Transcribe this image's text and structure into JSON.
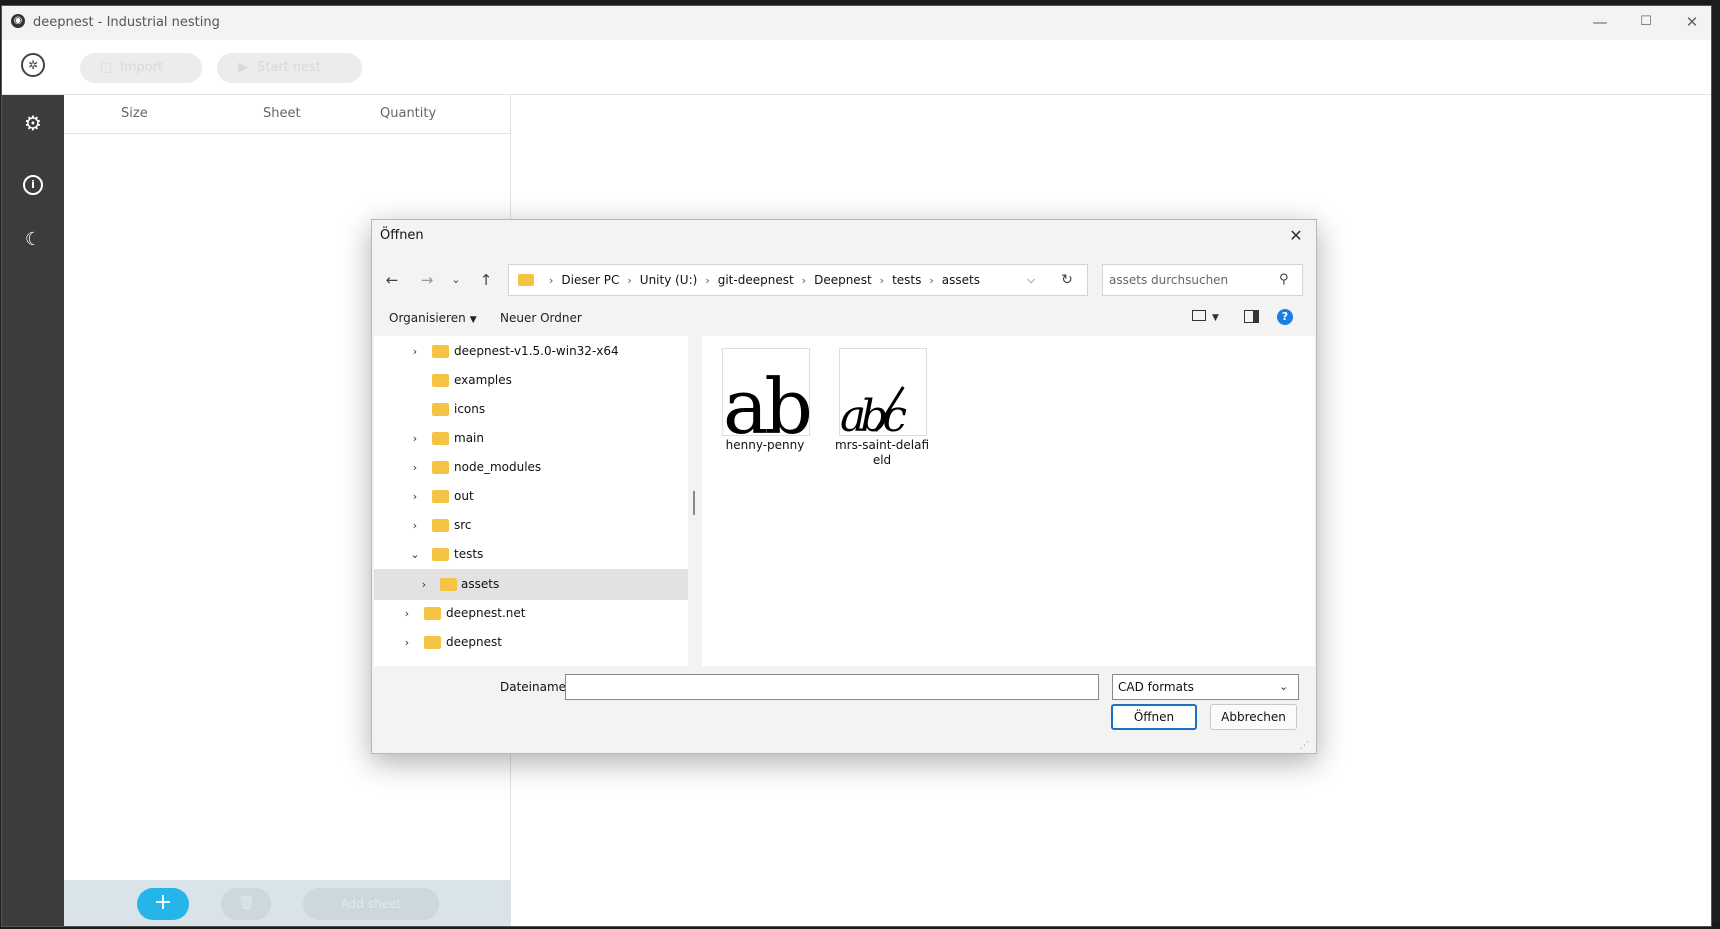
{
  "window": {
    "title": "deepnest - Industrial nesting",
    "controls": {
      "minimize": "—",
      "maximize": "☐",
      "close": "✕"
    }
  },
  "toolbar": {
    "import_label": "Import",
    "start_label": "Start nest",
    "import_icon": "file-import-icon",
    "start_icon": "play-icon"
  },
  "sidenav": {
    "icons": [
      "gear-icon",
      "info-icon",
      "moon-icon"
    ],
    "settings_glyph": "⚙",
    "info_glyph": "i",
    "dark_glyph": "☾"
  },
  "parts": {
    "columns": [
      "Size",
      "Sheet",
      "Quantity"
    ],
    "add_label": "+",
    "delete_label": "🗑",
    "add_sheet_label": "Add sheet"
  },
  "dialog": {
    "title": "Öffnen",
    "close": "✕",
    "nav": {
      "back": "←",
      "forward": "→",
      "recent": "⌄",
      "up": "↑",
      "dropdown": "⌵",
      "refresh": "↻"
    },
    "breadcrumb": [
      "Dieser PC",
      "Unity (U:)",
      "git-deepnest",
      "Deepnest",
      "tests",
      "assets"
    ],
    "search_placeholder": "assets durchsuchen",
    "organize_label": "Organisieren",
    "new_folder_label": "Neuer Ordner",
    "help": "?",
    "tree": [
      {
        "label": "deepnest-v1.5.0-win32-x64",
        "expandable": true,
        "expanded": false
      },
      {
        "label": "examples",
        "expandable": false
      },
      {
        "label": "icons",
        "expandable": false
      },
      {
        "label": "main",
        "expandable": true,
        "expanded": false
      },
      {
        "label": "node_modules",
        "expandable": true,
        "expanded": false
      },
      {
        "label": "out",
        "expandable": true,
        "expanded": false
      },
      {
        "label": "src",
        "expandable": true,
        "expanded": false
      },
      {
        "label": "tests",
        "expandable": true,
        "expanded": true
      },
      {
        "label": "assets",
        "expandable": true,
        "expanded": false,
        "selected": true
      },
      {
        "label": "deepnest.net",
        "expandable": true,
        "expanded": false
      },
      {
        "label": "deepnest",
        "expandable": true,
        "expanded": false
      }
    ],
    "files": [
      {
        "name": "henny-penny",
        "preview": "ab"
      },
      {
        "name": "mrs-saint-delafield",
        "preview": "abc"
      }
    ],
    "filename_label": "Dateiname:",
    "filename_value": "",
    "filetype": "CAD formats",
    "open_label": "Öffnen",
    "cancel_label": "Abbrechen"
  },
  "colors": {
    "accent": "#25b5e8",
    "sidenav": "#3a3c3e",
    "folder": "#f6c445",
    "primary_button_border": "#1b6fc5",
    "help_blue": "#1a7fe0"
  }
}
